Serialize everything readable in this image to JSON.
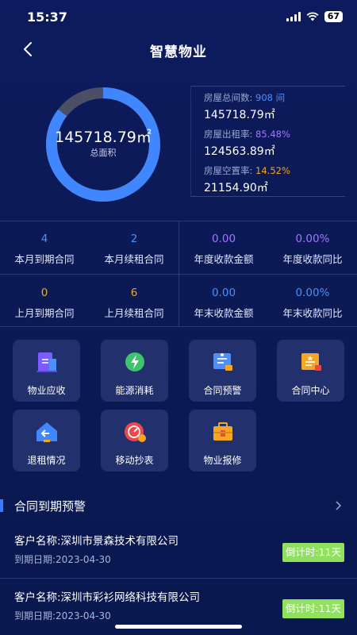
{
  "status_bar": {
    "time": "15:37",
    "battery": "67"
  },
  "nav": {
    "title": "智慧物业"
  },
  "summary": {
    "total_area_value": "145718.79㎡",
    "total_area_label": "总面积",
    "rented_fraction": 0.8548,
    "stats": [
      {
        "label": "房屋总间数: ",
        "highlight": "908 间",
        "value": "145718.79㎡",
        "color": "#4f8ff7"
      },
      {
        "label": "房屋出租率: ",
        "highlight": "85.48%",
        "value": "124563.89㎡",
        "color": "#a674ff"
      },
      {
        "label": "房屋空置率: ",
        "highlight": "14.52%",
        "value": "21154.90㎡",
        "color": "#f5a623"
      }
    ]
  },
  "metrics": [
    {
      "value": "4",
      "label": "本月到期合同"
    },
    {
      "value": "2",
      "label": "本月续租合同"
    },
    {
      "value": "0.00",
      "label": "年度收款金额"
    },
    {
      "value": "0.00%",
      "label": "年度收款同比"
    },
    {
      "value": "0",
      "label": "上月到期合同"
    },
    {
      "value": "6",
      "label": "上月续租合同"
    },
    {
      "value": "0.00",
      "label": "年末收款金额"
    },
    {
      "value": "0.00%",
      "label": "年末收款同比"
    }
  ],
  "tiles": [
    {
      "label": "物业应收",
      "icon": "receivable-icon"
    },
    {
      "label": "能源消耗",
      "icon": "energy-icon"
    },
    {
      "label": "合同预警",
      "icon": "contract-warning-icon"
    },
    {
      "label": "合同中心",
      "icon": "contract-center-icon"
    },
    {
      "label": "退租情况",
      "icon": "move-out-icon"
    },
    {
      "label": "移动抄表",
      "icon": "meter-reading-icon"
    },
    {
      "label": "物业报修",
      "icon": "repair-icon"
    }
  ],
  "section": {
    "title": "合同到期预警"
  },
  "contracts": [
    {
      "name": "客户名称:深圳市景森技术有限公司",
      "date": "到期日期:2023-04-30",
      "countdown": "倒计时:11天"
    },
    {
      "name": "客户名称:深圳市彩衫网络科技有限公司",
      "date": "到期日期:2023-04-30",
      "countdown": "倒计时:11天"
    }
  ],
  "colors": {
    "accent": "#4f8ff7",
    "countdown_bg": "#8fe15e",
    "background": "#0d1b5e"
  }
}
